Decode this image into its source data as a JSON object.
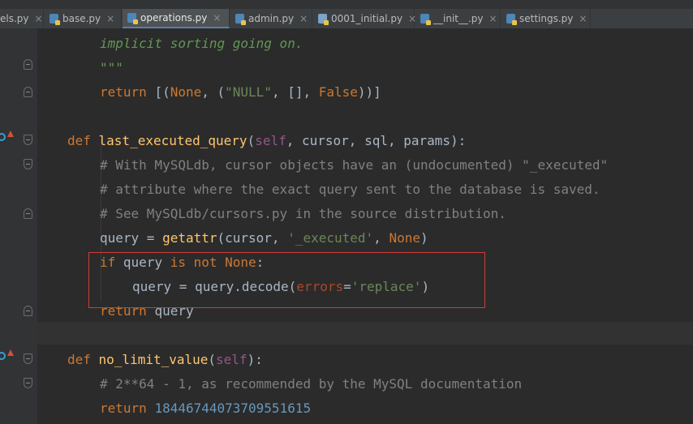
{
  "tabs": [
    {
      "label": "els.py",
      "active": false
    },
    {
      "label": "base.py",
      "active": false
    },
    {
      "label": "operations.py",
      "active": true
    },
    {
      "label": "admin.py",
      "active": false
    },
    {
      "label": "0001_initial.py",
      "active": false
    },
    {
      "label": "__init__.py",
      "active": false
    },
    {
      "label": "settings.py",
      "active": false
    }
  ],
  "tab_close_glyph": "×",
  "code": {
    "l1": {
      "doc": "implicit sorting going on."
    },
    "l2": {
      "doc": "\"\"\""
    },
    "l3": {
      "ret": "return ",
      "p1": "[(",
      "none": "None",
      "p2": ", (",
      "s": "\"NULL\"",
      "p3": ", [], ",
      "f": "False",
      "p4": "))]"
    },
    "l5": {
      "def": "def ",
      "name": "last_executed_query",
      "p1": "(",
      "self": "self",
      "rest": ", cursor, sql, params):"
    },
    "l6": {
      "cmt": "# With MySQLdb, cursor objects have an (undocumented) \"_executed\""
    },
    "l7": {
      "cmt": "# attribute where the exact query sent to the database is saved."
    },
    "l8": {
      "cmt": "# See MySQLdb/cursors.py in the source distribution."
    },
    "l9": {
      "a": "query = ",
      "fn": "getattr",
      "b": "(cursor, ",
      "s": "'_executed'",
      "c": ", ",
      "none": "None",
      "d": ")"
    },
    "l10": {
      "kw1": "if ",
      "a": "query ",
      "kw2": "is not None",
      "b": ":"
    },
    "l11": {
      "a": "query = query.decode(",
      "param": "errors",
      "b": "=",
      "s": "'replace'",
      "c": ")"
    },
    "l12": {
      "ret": "return ",
      "a": "query"
    },
    "l14": {
      "def": "def ",
      "name": "no_limit_value",
      "p1": "(",
      "self": "self",
      "rest": "):"
    },
    "l15": {
      "cmt": "# 2**64 - 1, as recommended by the MySQL documentation"
    },
    "l16": {
      "ret": "return ",
      "num": "18446744073709551615"
    }
  },
  "colors": {
    "background": "#2b2b2b",
    "keyword": "#cc7832",
    "function": "#ffc66d",
    "comment": "#808080",
    "string": "#6a8759",
    "number": "#6897bb",
    "highlight_box": "#d23a3a"
  }
}
